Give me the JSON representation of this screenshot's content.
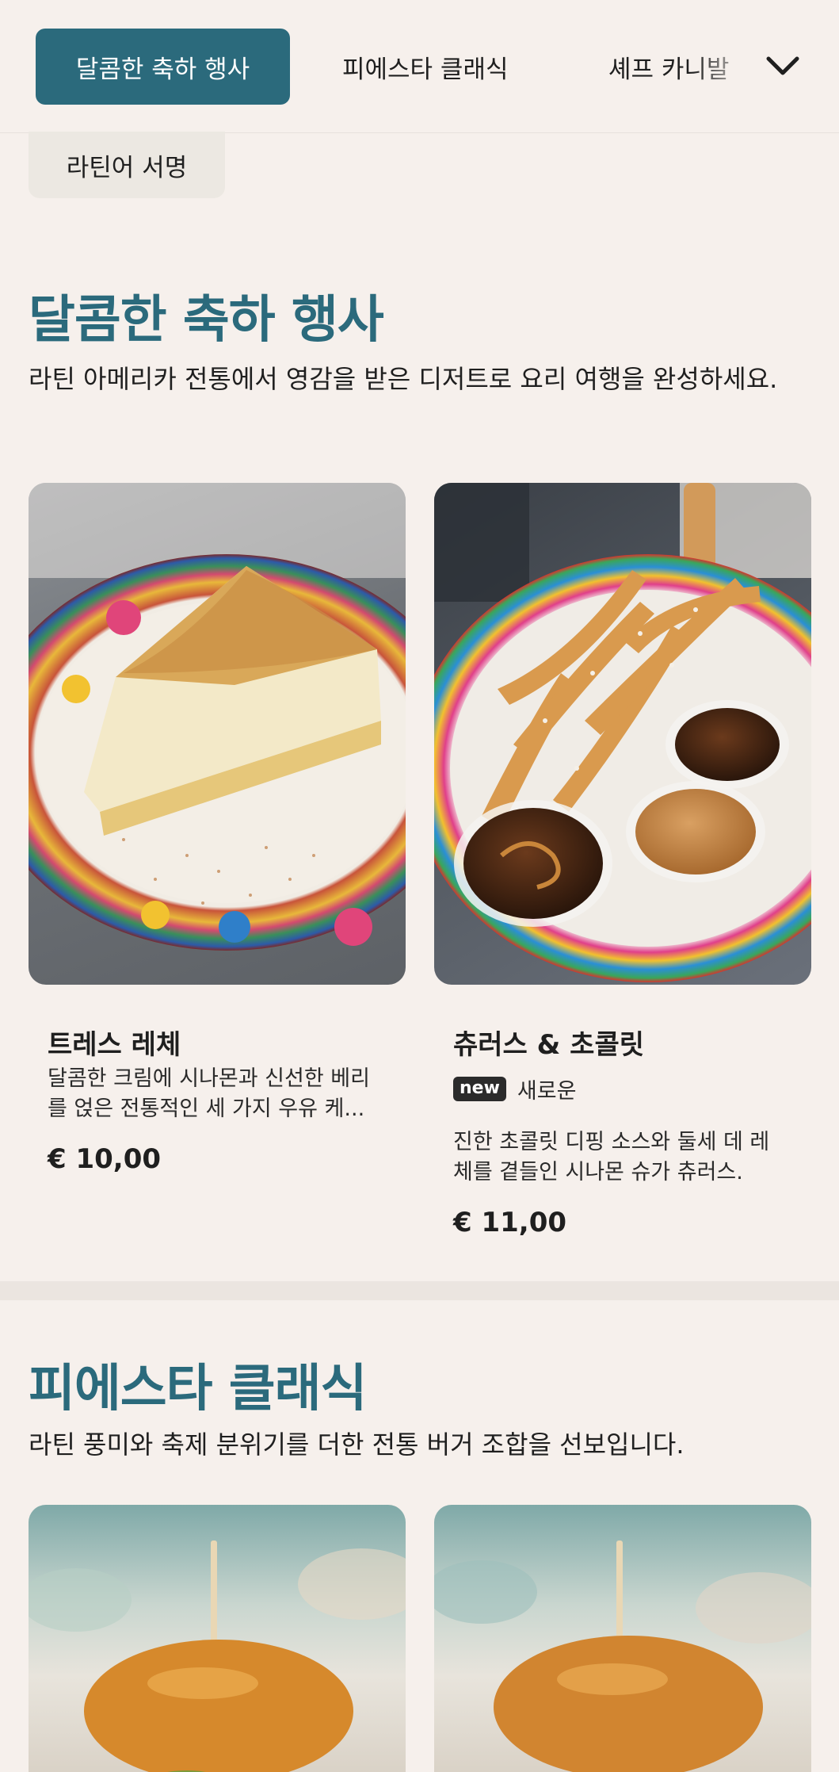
{
  "nav": {
    "tabs": [
      {
        "label": "달콤한 축하 행사",
        "active": true
      },
      {
        "label": "피에스타 클래식",
        "active": false
      },
      {
        "label": "셰프 카니발",
        "active": false
      }
    ],
    "more_icon": "chevron-down-icon",
    "extra_pill": "라틴어 서명"
  },
  "sections": [
    {
      "title": "달콤한 축하 행사",
      "description": "라틴 아메리카 전통에서 영감을 받은 디저트로 요리 여행을 완성하세요.",
      "items": [
        {
          "name": "트레스 레체",
          "description": "달콤한 크림에 시나몬과 신선한 베리를 얹은 전통적인 세 가지 우유 케...",
          "price": "€ 10,00",
          "image": "tres-leches-photo"
        },
        {
          "name": "츄러스 & 초콜릿",
          "badge": "new",
          "badge_label": "새로운",
          "description": "진한 초콜릿 디핑 소스와 둘세 데 레체를 곁들인 시나몬 슈가 츄러스.",
          "price": "€ 11,00",
          "image": "churros-photo"
        }
      ]
    },
    {
      "title": "피에스타 클래식",
      "description": "라틴 풍미와 축제 분위기를 더한 전통 버거 조합을 선보입니다.",
      "items": [
        {
          "image": "burger-photo-1"
        },
        {
          "image": "burger-photo-2"
        }
      ]
    }
  ],
  "colors": {
    "accent": "#2b6a7c",
    "background": "#f6f0ec",
    "text": "#1f1f1f",
    "badge": "#2b2b2b"
  }
}
